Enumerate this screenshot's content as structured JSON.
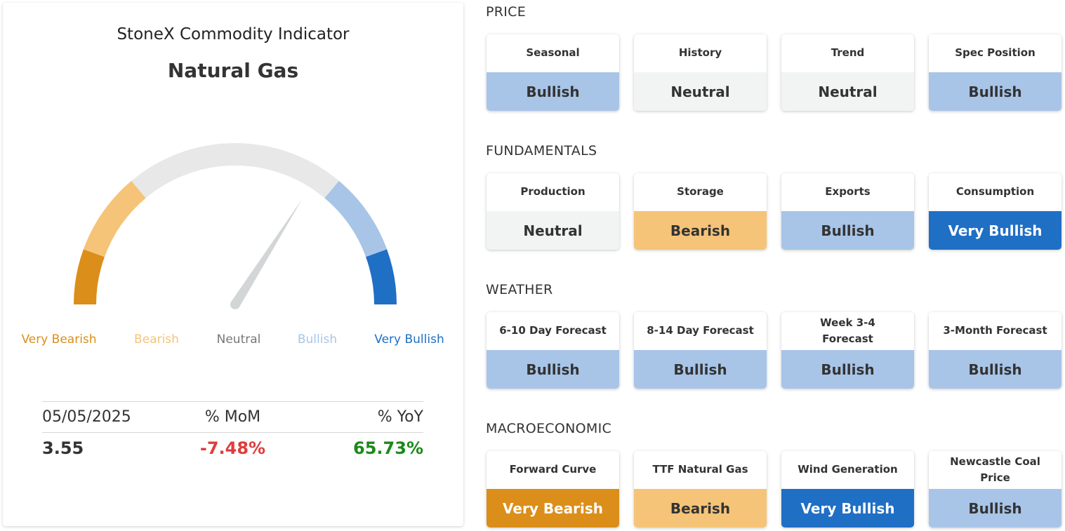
{
  "indicator": {
    "title": "StoneX Commodity Indicator",
    "commodity": "Natural Gas",
    "gauge_level": 0.68,
    "scale": [
      {
        "label": "Very Bearish",
        "color": "#db8e1a"
      },
      {
        "label": "Bearish",
        "color": "#f5c478"
      },
      {
        "label": "Neutral",
        "color": "#777777"
      },
      {
        "label": "Bullish",
        "color": "#a8c5e8"
      },
      {
        "label": "Very Bullish",
        "color": "#1f6fc5"
      }
    ],
    "stats": {
      "date": "05/05/2025",
      "mom_label": "% MoM",
      "yoy_label": "% YoY",
      "price": "3.55",
      "mom": "-7.48%",
      "yoy": "65.73%"
    }
  },
  "colors": {
    "Very Bearish": {
      "bg": "#db8e1a",
      "fg": "#ffffff"
    },
    "Bearish": {
      "bg": "#f5c478",
      "fg": "#333333"
    },
    "Neutral": {
      "bg": "#f2f3f3",
      "fg": "#333333"
    },
    "Bullish": {
      "bg": "#a8c5e8",
      "fg": "#333333"
    },
    "Very Bullish": {
      "bg": "#1f6fc5",
      "fg": "#ffffff"
    }
  },
  "sections": [
    {
      "title": "PRICE",
      "tiles": [
        {
          "label": "Seasonal",
          "value": "Bullish"
        },
        {
          "label": "History",
          "value": "Neutral"
        },
        {
          "label": "Trend",
          "value": "Neutral"
        },
        {
          "label": "Spec Position",
          "value": "Bullish"
        }
      ]
    },
    {
      "title": "FUNDAMENTALS",
      "tiles": [
        {
          "label": "Production",
          "value": "Neutral"
        },
        {
          "label": "Storage",
          "value": "Bearish"
        },
        {
          "label": "Exports",
          "value": "Bullish"
        },
        {
          "label": "Consumption",
          "value": "Very Bullish"
        }
      ]
    },
    {
      "title": "WEATHER",
      "tiles": [
        {
          "label": "6-10 Day Forecast",
          "value": "Bullish"
        },
        {
          "label": "8-14 Day Forecast",
          "value": "Bullish"
        },
        {
          "label": "Week 3-4 Forecast",
          "value": "Bullish"
        },
        {
          "label": "3-Month Forecast",
          "value": "Bullish"
        }
      ]
    },
    {
      "title": "MACROECONOMIC",
      "tiles": [
        {
          "label": "Forward Curve",
          "value": "Very Bearish"
        },
        {
          "label": "TTF Natural Gas",
          "value": "Bearish"
        },
        {
          "label": "Wind Generation",
          "value": "Very Bullish"
        },
        {
          "label": "Newcastle Coal Price",
          "value": "Bullish"
        }
      ]
    }
  ]
}
